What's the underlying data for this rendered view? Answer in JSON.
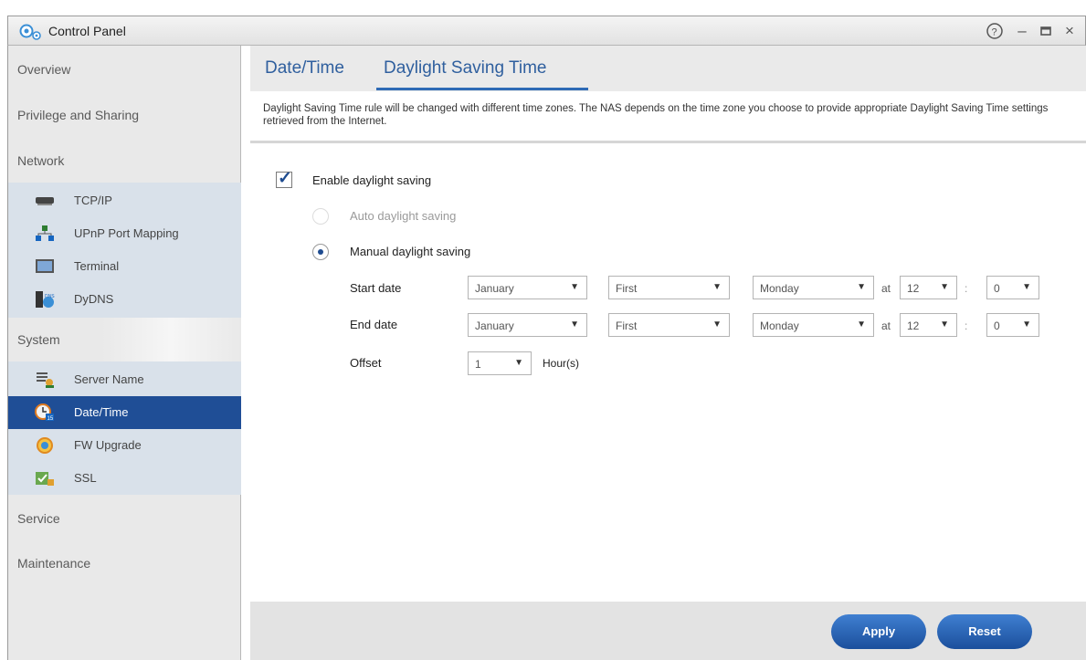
{
  "window": {
    "title": "Control Panel"
  },
  "sidebar": {
    "categories": {
      "overview": "Overview",
      "privilege": "Privilege and Sharing",
      "network": "Network",
      "system": "System",
      "service": "Service",
      "maintenance": "Maintenance"
    },
    "network_items": [
      "TCP/IP",
      "UPnP Port Mapping",
      "Terminal",
      "DyDNS"
    ],
    "system_items": [
      "Server Name",
      "Date/Time",
      "FW Upgrade",
      "SSL"
    ],
    "active_item": "Date/Time"
  },
  "tabs": [
    "Date/Time",
    "Daylight Saving Time"
  ],
  "active_tab": "Daylight Saving Time",
  "description": "Daylight Saving Time rule will be changed with different time zones. The NAS depends on the time zone you choose to provide appropriate Daylight Saving Time settings retrieved from the Internet.",
  "form": {
    "enable_label": "Enable daylight saving",
    "enable_checked": true,
    "auto_label": "Auto daylight saving",
    "manual_label": "Manual daylight saving",
    "mode_selected": "manual",
    "start_label": "Start date",
    "end_label": "End date",
    "offset_label": "Offset",
    "at_label": "at",
    "colon": ":",
    "start": {
      "month": "January",
      "week": "First",
      "day": "Monday",
      "hour": "12",
      "minute": "0"
    },
    "end": {
      "month": "January",
      "week": "First",
      "day": "Monday",
      "hour": "12",
      "minute": "0"
    },
    "offset_value": "1",
    "offset_unit": "Hour(s)"
  },
  "buttons": {
    "apply": "Apply",
    "reset": "Reset"
  },
  "colors": {
    "accent": "#1f4e96",
    "tab_text": "#2f5f9e",
    "sidebar_sub_bg": "#d9e1ea"
  }
}
